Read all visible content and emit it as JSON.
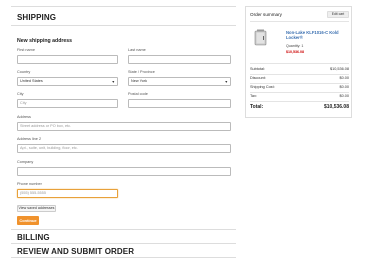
{
  "shipping": {
    "title": "SHIPPING",
    "subtitle": "New shipping address",
    "fields": {
      "first_name": {
        "label": "First name",
        "value": ""
      },
      "last_name": {
        "label": "Last name",
        "value": ""
      },
      "country": {
        "label": "Country",
        "value": "United States"
      },
      "state": {
        "label": "State / Province",
        "value": "New York"
      },
      "city": {
        "label": "City",
        "placeholder": "City"
      },
      "postal": {
        "label": "Postal code",
        "value": ""
      },
      "address": {
        "label": "Address",
        "placeholder": "Street address or PO box, etc."
      },
      "address2": {
        "label": "Address line 2",
        "placeholder": "Apt., suite, unit, building, floor, etc."
      },
      "company": {
        "label": "Company",
        "value": ""
      },
      "phone": {
        "label": "Phone number",
        "placeholder": "(555) 555-5555"
      }
    },
    "view_saved_label": "View saved addresses",
    "continue_label": "Continue"
  },
  "billing": {
    "title": "BILLING"
  },
  "review": {
    "title": "REVIEW AND SUBMIT ORDER"
  },
  "summary": {
    "title": "Order summary",
    "edit_cart_label": "Edit cart",
    "product": {
      "name": "Non-Lake KLF1016-C Kold Locker®",
      "quantity": "Quantity: 1",
      "price": "$10,536.08"
    },
    "rows": [
      {
        "label": "Subtotal:",
        "value": "$10,536.08"
      },
      {
        "label": "Discount:",
        "value": "$0.00"
      },
      {
        "label": "Shipping Cost:",
        "value": "$0.00"
      },
      {
        "label": "Tax:",
        "value": "$0.00"
      }
    ],
    "total": {
      "label": "Total:",
      "value": "$10,536.08"
    }
  },
  "colors": {
    "accent": "#f0922c",
    "link": "#3a6fb0",
    "price": "#cc0000"
  }
}
